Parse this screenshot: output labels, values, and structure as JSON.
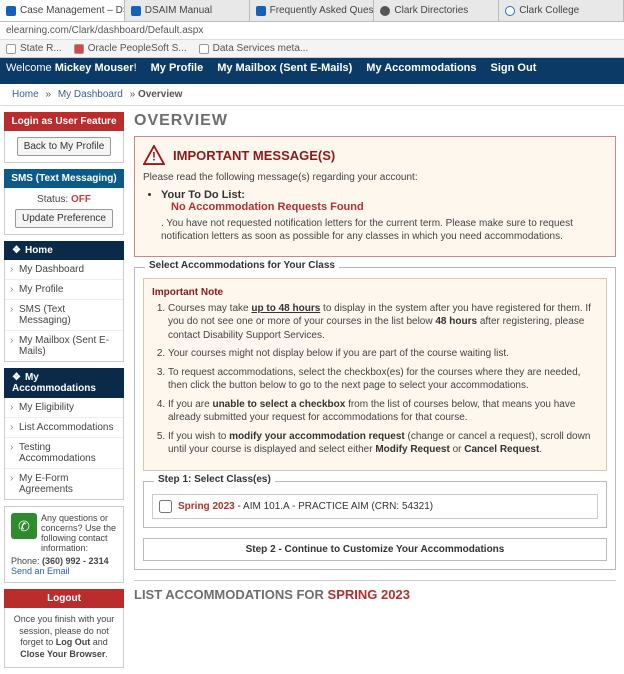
{
  "browser": {
    "tabs": [
      {
        "label": "Case Management – DSAIM",
        "active": true
      },
      {
        "label": "DSAIM Manual"
      },
      {
        "label": "Frequently Asked Questions – D"
      },
      {
        "label": "Clark Directories"
      },
      {
        "label": "Clark College"
      }
    ],
    "address": "elearning.com/Clark/dashboard/Default.aspx",
    "bookmarks": [
      "State R...",
      "Oracle PeopleSoft S...",
      "Data Services meta..."
    ]
  },
  "topnav": {
    "welcome_prefix": "Welcome ",
    "welcome_name": "Mickey Mouser",
    "welcome_suffix": "!",
    "items": [
      "My Profile",
      "My Mailbox (Sent E-Mails)",
      "My Accommodations",
      "Sign Out"
    ]
  },
  "breadcrumb": {
    "home": "Home",
    "dash": "My Dashboard",
    "current": "Overview",
    "sep": "»"
  },
  "sidebar": {
    "login_feature_label": "Login as User Feature",
    "back_button": "Back to My Profile",
    "sms_label": "SMS (Text Messaging)",
    "sms_status_label": "Status: ",
    "sms_status_value": "OFF",
    "update_pref": "Update Preference",
    "home_label": "Home",
    "home_items": [
      "My Dashboard",
      "My Profile",
      "SMS (Text Messaging)",
      "My Mailbox (Sent E-Mails)"
    ],
    "accom_label": "My Accommodations",
    "accom_items": [
      "My Eligibility",
      "List Accommodations",
      "Testing Accommodations",
      "My E-Form Agreements"
    ],
    "contact_intro": "Any questions or concerns? Use the following contact information:",
    "phone_label": "Phone: ",
    "phone_number": "(360) 992 - 2314",
    "send_email": "Send an Email",
    "logout_label": "Logout",
    "logout_text_1": "Once you finish with your session, please do not forget to ",
    "logout_bold_1": "Log Out",
    "logout_text_2": " and ",
    "logout_bold_2": "Close Your Browser",
    "logout_text_3": "."
  },
  "overview": {
    "title": "OVERVIEW",
    "msg_title": "IMPORTANT MESSAGE(S)",
    "msg_intro": "Please read the following message(s) regarding your account:",
    "todo_label": "Your To Do List:",
    "no_found": "No Accommodation Requests Found",
    "todo_text": ". You have not requested notification letters for the current term. Please make sure to request notification letters as soon as possible for any classes in which you need accommodations.",
    "select_legend": "Select Accommodations for Your Class",
    "important_note": "Important Note",
    "notes": {
      "n1a": "Courses may take ",
      "n1b": "up to 48 hours",
      "n1c": " to display in the system after you have registered for them. If you do not see one or more of your courses in the list below ",
      "n1d": "48 hours",
      "n1e": " after registering, please contact Disability Support Services.",
      "n2": "Your courses might not display below if you are part of the course waiting list.",
      "n3": "To request accommodations, select the checkbox(es) for the courses where they are needed, then click the button below to go to the next page to select your accommodations.",
      "n4a": "If you are ",
      "n4b": "unable to select a checkbox",
      "n4c": " from the list of courses below, that means you have already submitted your request for accommodations for that course.",
      "n5a": "If you wish to ",
      "n5b": "modify your accommodation request",
      "n5c": " (change or cancel a request), scroll down until your course is displayed and select either ",
      "n5d": "Modify Request",
      "n5e": " or ",
      "n5f": "Cancel Request",
      "n5g": "."
    },
    "step1_legend": "Step 1: Select Class(es)",
    "class_term": "Spring 2023",
    "class_rest": " - AIM 101.A - PRACTICE AIM (CRN: 54321)",
    "step2_label": "Step 2 - Continue to Customize Your Accommodations",
    "list_title_prefix": "LIST ACCOMMODATIONS FOR ",
    "list_title_term": "SPRING 2023"
  }
}
